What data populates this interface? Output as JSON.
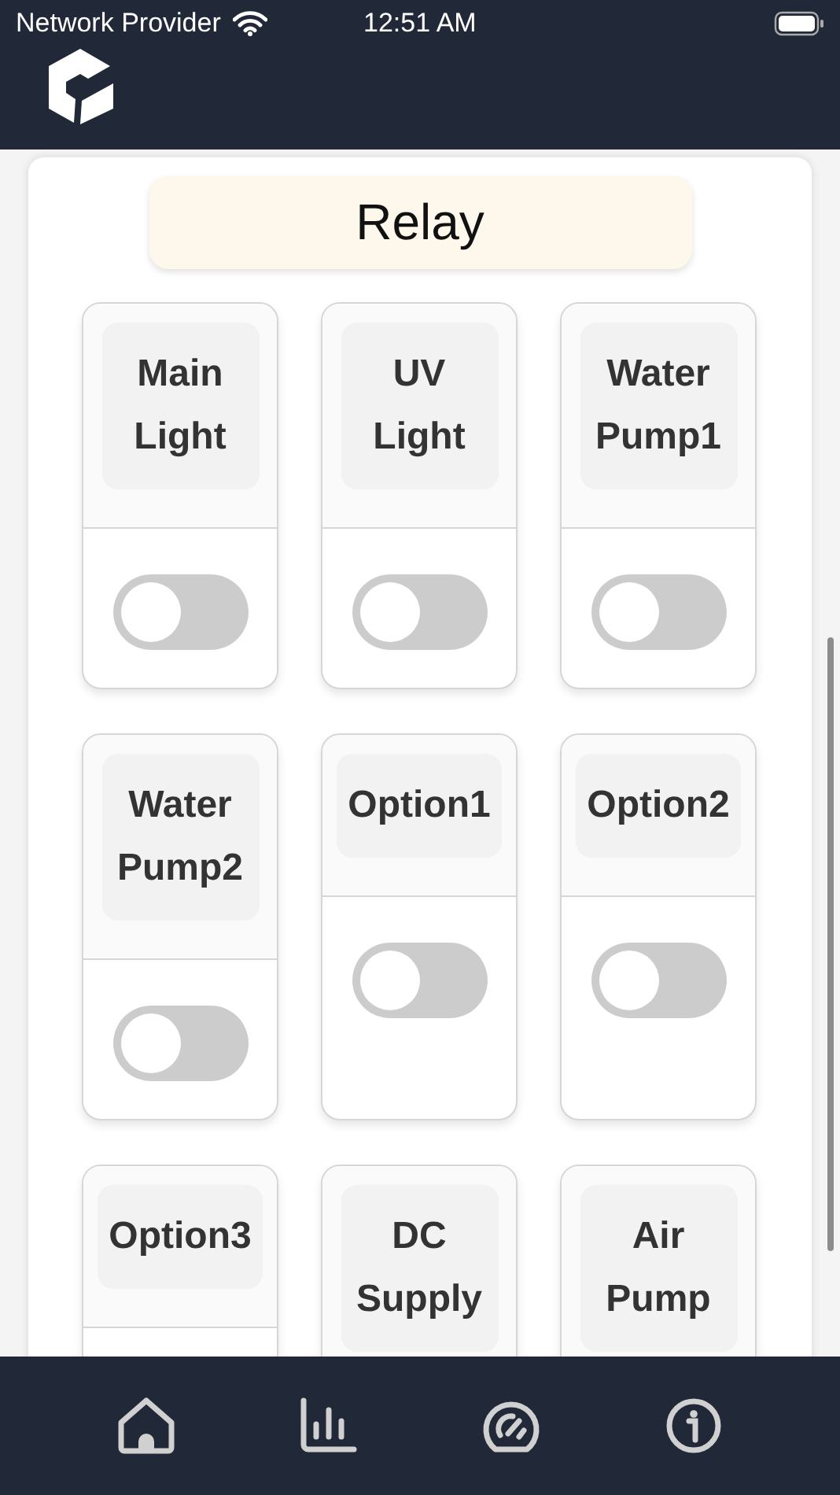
{
  "status_bar": {
    "carrier": "Network Provider",
    "time": "12:51 AM"
  },
  "section": {
    "title": "Relay"
  },
  "relays": [
    {
      "label": "Main\nLight",
      "on": false
    },
    {
      "label": "UV\nLight",
      "on": false
    },
    {
      "label": "Water\nPump1",
      "on": false
    },
    {
      "label": "Water\nPump2",
      "on": false
    },
    {
      "label": "Option1",
      "on": false
    },
    {
      "label": "Option2",
      "on": false
    },
    {
      "label": "Option3"
    },
    {
      "label": "DC\nSupply"
    },
    {
      "label": "Air\nPump"
    }
  ],
  "nav": [
    {
      "kind": "home"
    },
    {
      "kind": "chart"
    },
    {
      "kind": "gauge"
    },
    {
      "kind": "info"
    }
  ]
}
